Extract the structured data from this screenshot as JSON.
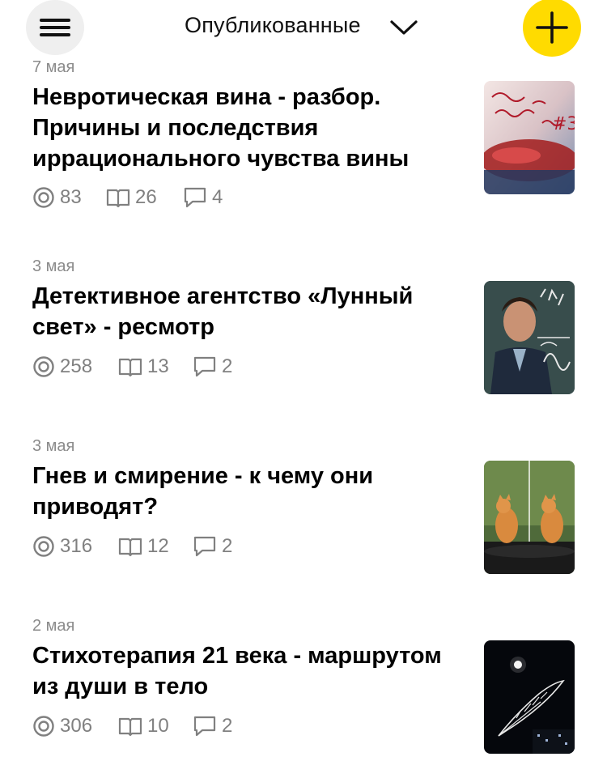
{
  "header": {
    "title": "Опубликованные",
    "menu_icon": "hamburger-menu-icon",
    "dropdown_icon": "chevron-down-icon",
    "add_icon": "plus-icon",
    "accent_color": "#ffdb00"
  },
  "articles": [
    {
      "date": "7 мая",
      "title": "Невротическая вина - разбор. Причины и последствия иррационального чувства вины",
      "views": "83",
      "reads": "26",
      "comments": "4",
      "thumbnail": "handwritten-note-wine-glass-image"
    },
    {
      "date": "3 мая",
      "title": "Детективное агентство «Лунный свет» - ресмотр",
      "views": "258",
      "reads": "13",
      "comments": "2",
      "thumbnail": "man-in-suit-tv-still-image"
    },
    {
      "date": "3 мая",
      "title": "Гнев и смирение - к чему они приводят?",
      "views": "316",
      "reads": "12",
      "comments": "2",
      "thumbnail": "two-ginger-cats-image"
    },
    {
      "date": "2 мая",
      "title": "Стихотерапия 21 века - маршрутом из души в тело",
      "views": "306",
      "reads": "10",
      "comments": "2",
      "thumbnail": "night-moon-feather-image"
    }
  ]
}
